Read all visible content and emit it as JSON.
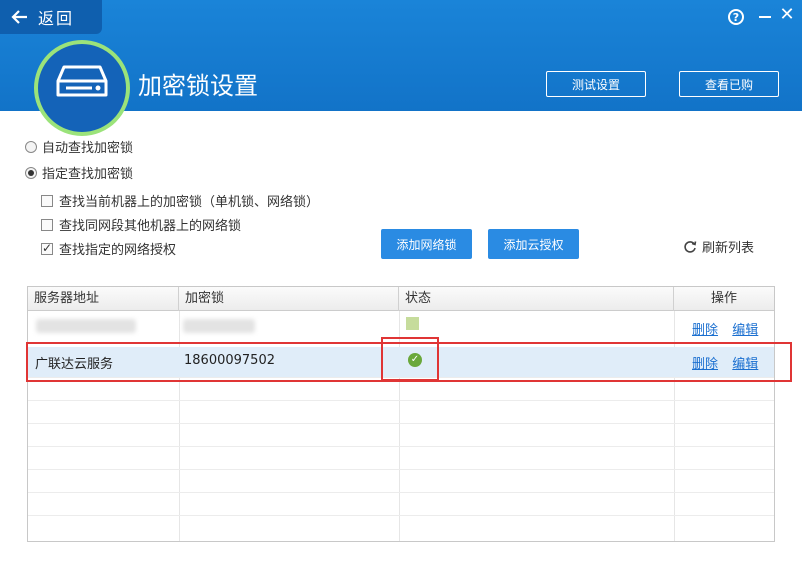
{
  "header": {
    "back_label": "返回",
    "title": "加密锁设置",
    "test_button": "测试设置",
    "purchased_button": "查看已购",
    "help_glyph": "?",
    "close_glyph": "✕"
  },
  "options": {
    "auto_find": "自动查找加密锁",
    "specified_find": "指定查找加密锁",
    "selected_mode": "specified",
    "checkbox_local": "查找当前机器上的加密锁（单机锁、网络锁）",
    "checkbox_local_checked": false,
    "checkbox_segment": "查找同网段其他机器上的网络锁",
    "checkbox_segment_checked": false,
    "checkbox_network": "查找指定的网络授权",
    "checkbox_network_checked": true
  },
  "buttons": {
    "add_network_lock": "添加网络锁",
    "add_cloud_auth": "添加云授权",
    "refresh_list": "刷新列表"
  },
  "table": {
    "columns": [
      "服务器地址",
      "加密锁",
      "状态",
      "操作"
    ],
    "rows": [
      {
        "server": "",
        "lock": "",
        "status": "pending",
        "delete": "删除",
        "edit": "编辑",
        "blurred": true
      },
      {
        "server": "广联达云服务",
        "lock": "18600097502",
        "status": "ok",
        "delete": "删除",
        "edit": "编辑",
        "selected": true
      }
    ]
  },
  "colors": {
    "header_bg": "#1273c8",
    "accent_button": "#2a8be3",
    "link": "#1a6fd0",
    "highlight_box": "#e03535",
    "status_ok": "#6aa83b"
  },
  "icons": {
    "back": "arrow-left-icon",
    "help": "help-icon",
    "minimize": "minimize-icon",
    "close": "close-icon",
    "logo": "lock-device-icon",
    "refresh": "refresh-icon",
    "status_ok": "check-circle-icon"
  }
}
